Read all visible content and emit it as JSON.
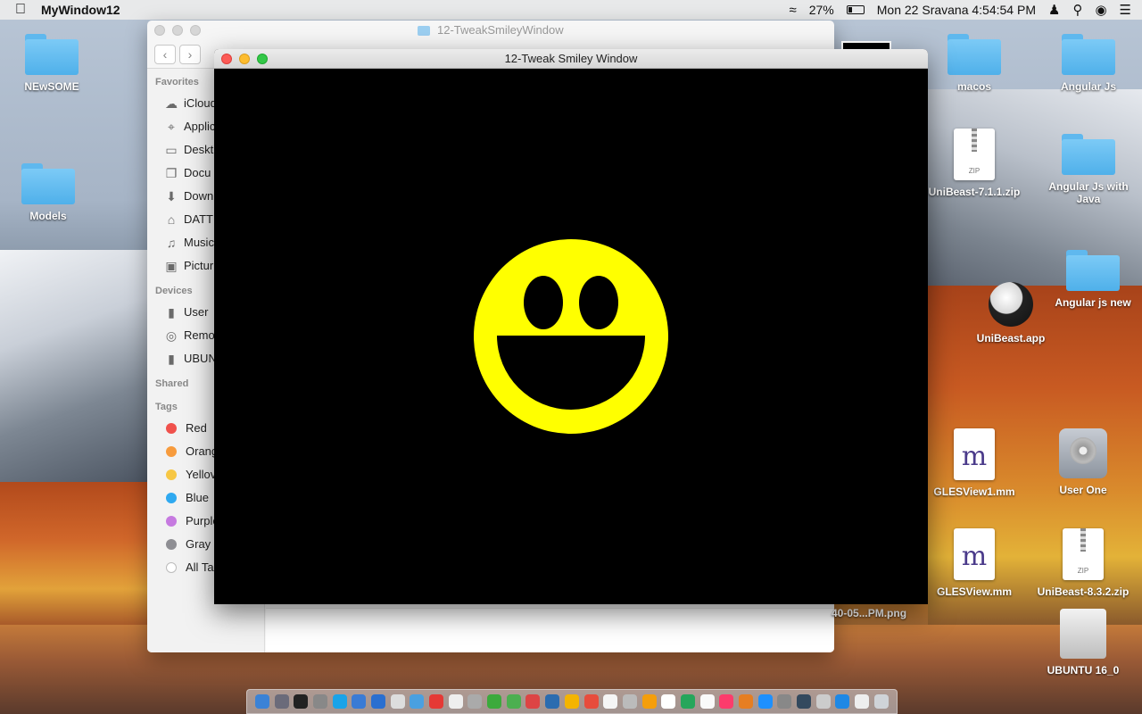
{
  "menubar": {
    "app_name": "MyWindow12",
    "battery": "27%",
    "battery_level": 0.27,
    "datetime": "Mon 22 Sravana  4:54:54 PM"
  },
  "desktop": {
    "left_icons": [
      {
        "label": "NEwSOME"
      },
      {
        "label": "Models"
      }
    ],
    "right_icons": {
      "macos": "macos",
      "angular_js": "Angular Js",
      "unibeast_zip1": "UniBeast-7.1.1.zip",
      "angular_js_java": "Angular Js with Java",
      "unibeast_app": "UniBeast.app",
      "angular_js_new": "Angular js new",
      "glesview1": "GLESView1.mm",
      "user_one": "User One",
      "glesview": "GLESView.mm",
      "unibeast_zip2": "UniBeast-8.3.2.zip",
      "ubuntu": "UBUNTU 16_0"
    },
    "partial_file": "40-05...PM.png",
    "zip_badge": "ZIP",
    "mm_glyph": "m"
  },
  "finder": {
    "title": "12-TweakSmileyWindow",
    "sections": {
      "favorites": "Favorites",
      "devices": "Devices",
      "shared": "Shared",
      "tags": "Tags"
    },
    "favorites": [
      {
        "label": "iCloud",
        "icon": "cloud-icon"
      },
      {
        "label": "Applic",
        "icon": "applications-icon"
      },
      {
        "label": "Deskt",
        "icon": "desktop-icon"
      },
      {
        "label": "Docu",
        "icon": "document-icon"
      },
      {
        "label": "Down",
        "icon": "download-icon"
      },
      {
        "label": "DATT",
        "icon": "home-icon"
      },
      {
        "label": "Music",
        "icon": "music-icon"
      },
      {
        "label": "Pictur",
        "icon": "camera-icon"
      }
    ],
    "devices": [
      {
        "label": "User",
        "icon": "drive-icon"
      },
      {
        "label": "Remo",
        "icon": "disc-icon"
      },
      {
        "label": "UBUN",
        "icon": "drive-icon"
      }
    ],
    "tags": [
      {
        "label": "Red",
        "color": "#f0514c"
      },
      {
        "label": "Orang",
        "color": "#f79b3d"
      },
      {
        "label": "Yellov",
        "color": "#f7c744"
      },
      {
        "label": "Blue",
        "color": "#2fa9f0"
      },
      {
        "label": "Purple",
        "color": "#c67ae0"
      },
      {
        "label": "Gray",
        "color": "#8e8e93"
      },
      {
        "label": "All Ta",
        "color": "#ffffff"
      }
    ]
  },
  "smiley_window": {
    "title": "12-Tweak Smiley Window",
    "colors": {
      "background": "#000000",
      "face": "#ffff00",
      "features": "#000000"
    }
  }
}
